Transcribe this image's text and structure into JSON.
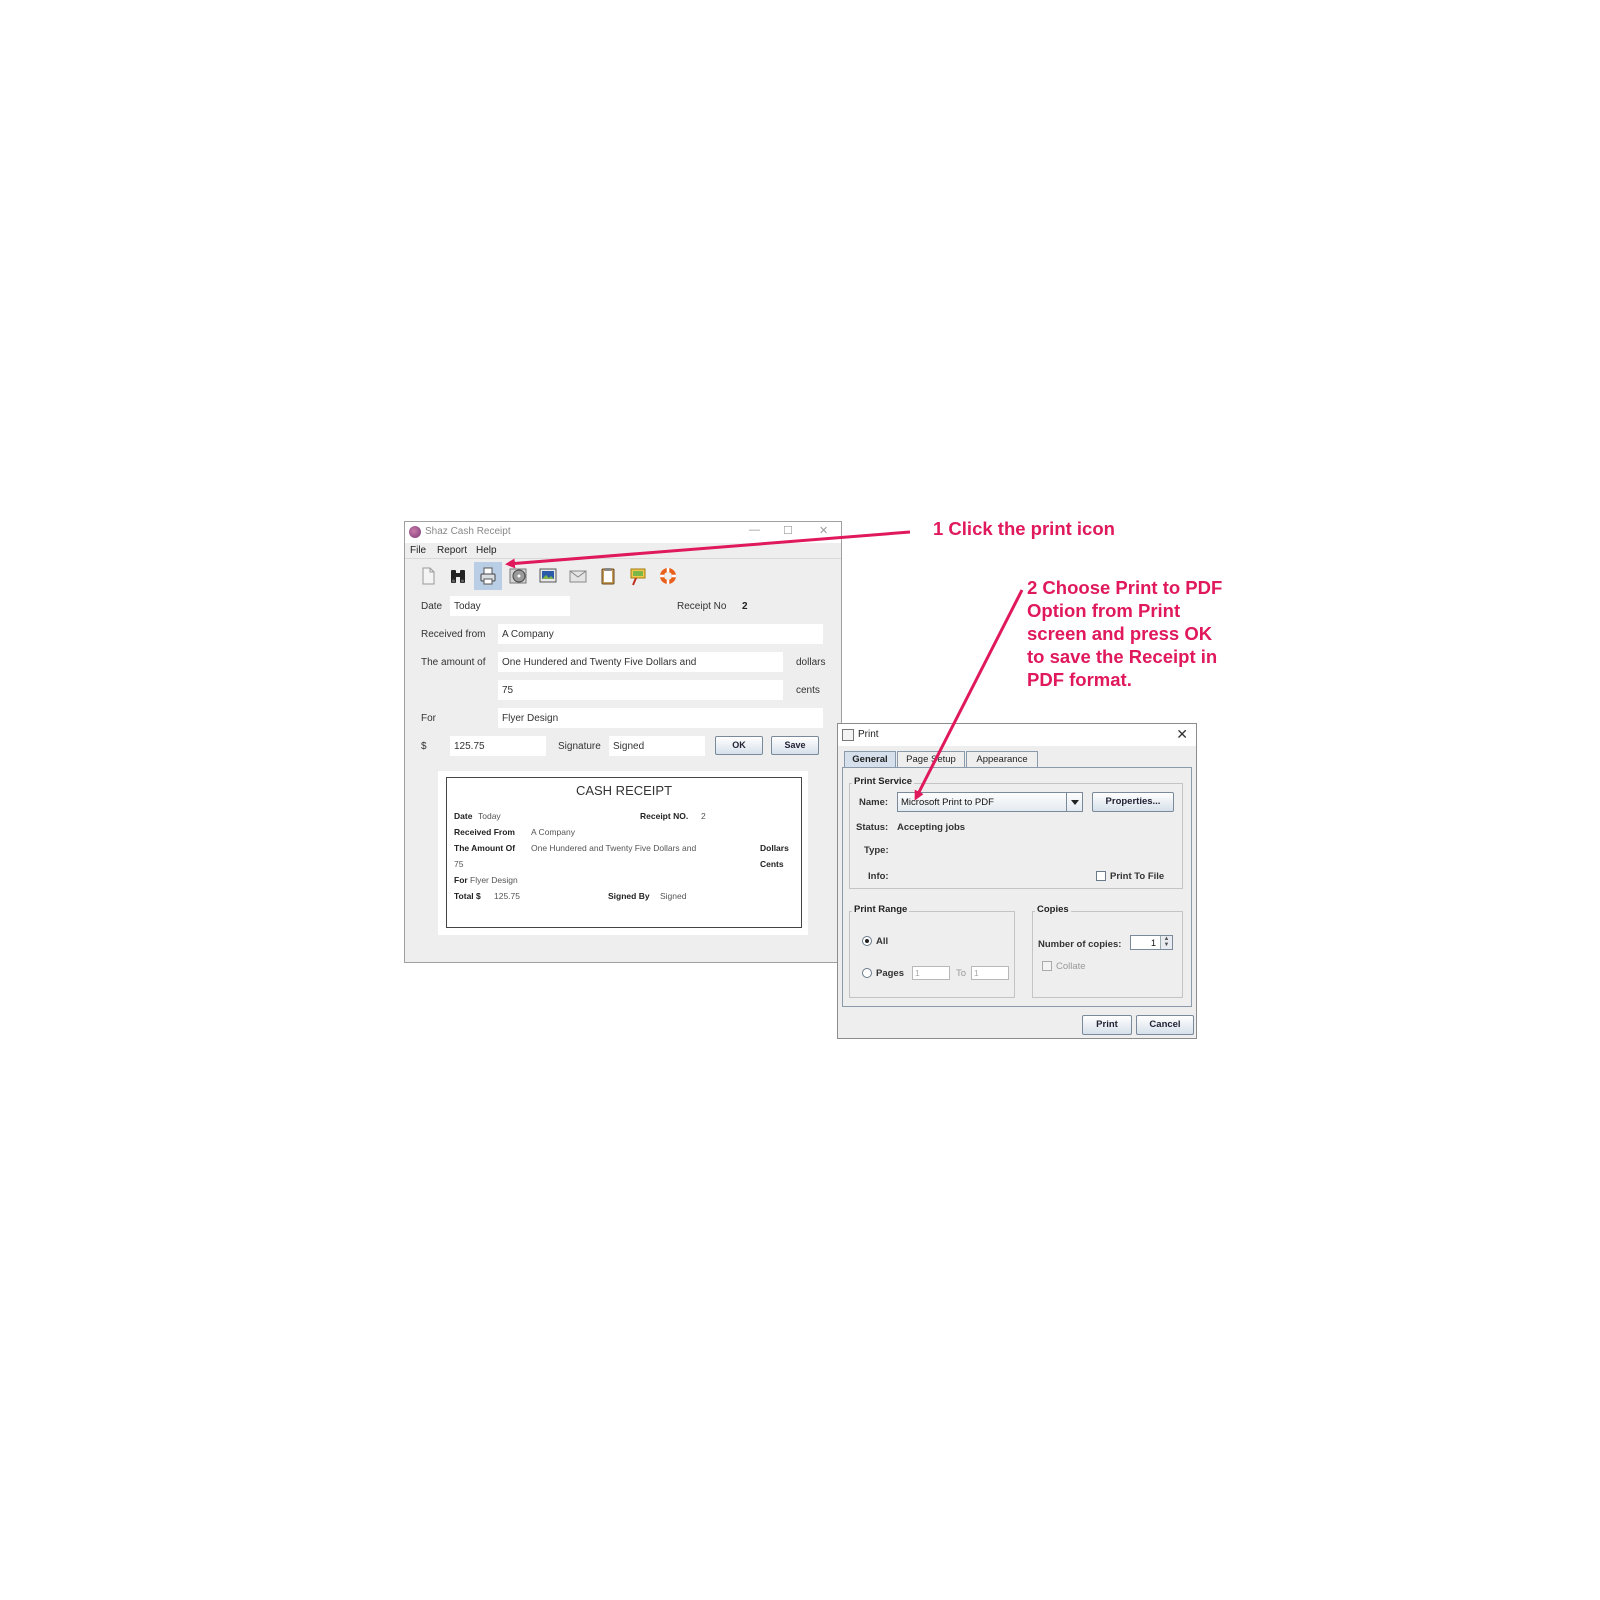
{
  "annotations": {
    "step1": "1 Click the print icon",
    "step2_lines": [
      "2 Choose Print to PDF",
      "Option from Print",
      "screen and press OK",
      "to save the Receipt in",
      "PDF format."
    ],
    "color": "#e0185c"
  },
  "main_window": {
    "title": "Shaz Cash Receipt",
    "controls": {
      "minimize": "—",
      "maximize": "☐",
      "close": "✕"
    },
    "menu": [
      "File",
      "Report",
      "Help"
    ],
    "toolbar_icons": [
      "new-document-icon",
      "binoculars-icon",
      "print-icon",
      "disc-icon",
      "image-icon",
      "envelope-icon",
      "clipboard-icon",
      "paint-icon",
      "lifebuoy-icon"
    ],
    "active_toolbar_icon": "print-icon",
    "form": {
      "date_label": "Date",
      "date_value": "Today",
      "receipt_no_label": "Receipt No",
      "receipt_no_value": "2",
      "received_from_label": "Received from",
      "received_from_value": "A Company",
      "amount_label": "The amount of",
      "amount_words": "One Hundered and Twenty Five Dollars and",
      "dollars_label": "dollars",
      "cents_value": "75",
      "cents_label": "cents",
      "for_label": "For",
      "for_value": "Flyer Design",
      "dollar_sign": "$",
      "total_value": "125.75",
      "signature_label": "Signature",
      "signature_value": "Signed",
      "ok_button": "OK",
      "save_button": "Save"
    },
    "preview": {
      "title": "CASH RECEIPT",
      "date_label": "Date",
      "date_value": "Today",
      "receipt_no_label": "Receipt NO.",
      "receipt_no_value": "2",
      "received_from_label": "Received From",
      "received_from_value": "A Company",
      "amount_label": "The Amount Of",
      "amount_value": "One Hundered and Twenty Five Dollars and",
      "dollars_label": "Dollars",
      "cents_value": "75",
      "cents_label": "Cents",
      "for_label": "For",
      "for_value": "Flyer Design",
      "total_label": "Total $",
      "total_value": "125.75",
      "signed_by_label": "Signed By",
      "signed_by_value": "Signed"
    }
  },
  "print_dialog": {
    "title": "Print",
    "close": "✕",
    "tabs": [
      "General",
      "Page Setup",
      "Appearance"
    ],
    "selected_tab": "General",
    "print_service": {
      "group_label": "Print Service",
      "name_label": "Name:",
      "name_value": "Microsoft Print to PDF",
      "properties_button": "Properties...",
      "status_label": "Status:",
      "status_value": "Accepting jobs",
      "type_label": "Type:",
      "info_label": "Info:",
      "print_to_file": "Print To File"
    },
    "print_range": {
      "group_label": "Print Range",
      "all": "All",
      "pages": "Pages",
      "from": "1",
      "to_label": "To",
      "to": "1"
    },
    "copies": {
      "group_label": "Copies",
      "number_label": "Number of copies:",
      "number_value": "1",
      "collate": "Collate"
    },
    "print_button": "Print",
    "cancel_button": "Cancel"
  }
}
